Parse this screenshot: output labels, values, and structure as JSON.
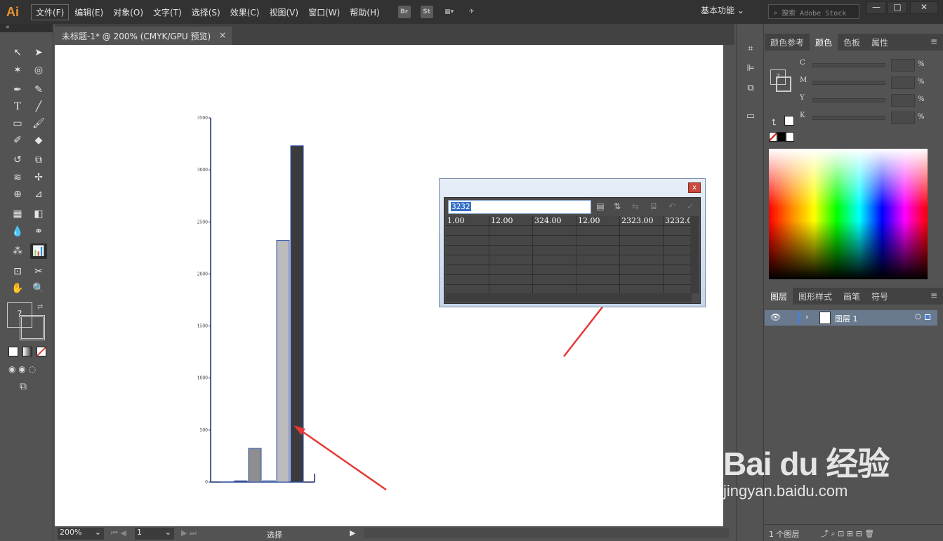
{
  "app": {
    "logo": "Ai"
  },
  "menu": [
    "文件(F)",
    "编辑(E)",
    "对象(O)",
    "文字(T)",
    "选择(S)",
    "效果(C)",
    "视图(V)",
    "窗口(W)",
    "帮助(H)"
  ],
  "menubar_icons": {
    "bridge": "Br",
    "stock": "St"
  },
  "workspace": "基本功能",
  "search_placeholder": "搜索 Adobe Stock",
  "document": {
    "tab_title": "未标题-1* @ 200% (CMYK/GPU 预览)",
    "close_glyph": "×"
  },
  "status": {
    "zoom": "200%",
    "page": "1",
    "tool": "选择"
  },
  "graph_dialog": {
    "input_value": "3232",
    "close_glyph": "x",
    "row0": [
      "1.00",
      "12.00",
      "324.00",
      "12.00",
      "2323.00",
      "3232.0"
    ]
  },
  "chart_data": {
    "type": "bar",
    "y_ticks": [
      "3500",
      "3000",
      "2500",
      "2000",
      "1500",
      "1000",
      "500",
      "0"
    ],
    "values": [
      1,
      12,
      324,
      12,
      2323,
      3232
    ],
    "ylim": [
      0,
      3500
    ]
  },
  "color_panel": {
    "tabs": [
      "颜色参考",
      "颜色",
      "色板",
      "属性"
    ],
    "active_tab": 1,
    "channels": [
      "C",
      "M",
      "Y",
      "K"
    ],
    "unit": "%"
  },
  "layers_panel": {
    "tabs": [
      "图层",
      "图形样式",
      "画笔",
      "符号"
    ],
    "layer_name": "图层 1",
    "footer": "1 个图层"
  },
  "watermark": {
    "main": "Bai du 经验",
    "sub": "jingyan.baidu.com"
  }
}
